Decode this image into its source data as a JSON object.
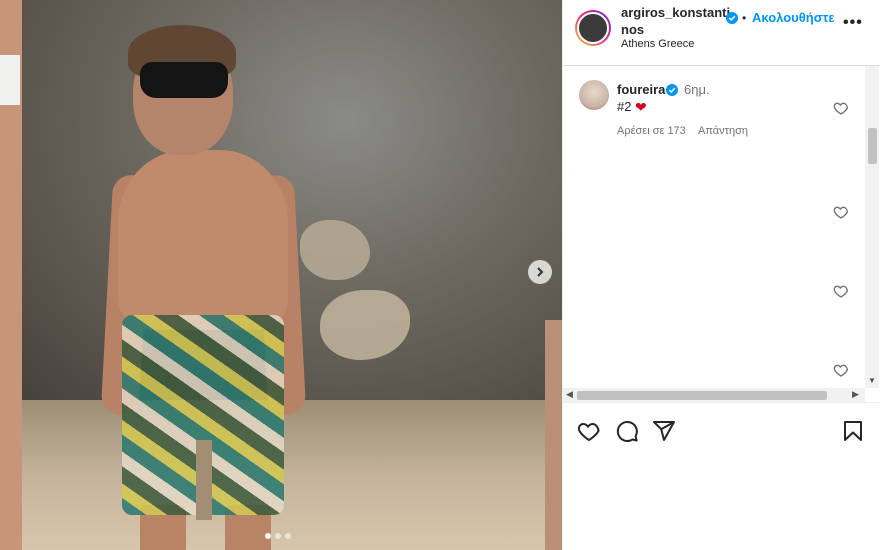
{
  "post": {
    "media": {
      "next_icon": "chevron-right-icon",
      "slides_total": 3,
      "active_slide": 1
    },
    "header": {
      "username": "argiros_konstantinos",
      "verified_icon": "verified-badge-icon",
      "separator": "•",
      "follow_label": "Ακολουθήστε",
      "location": "Athens Greece",
      "more_icon": "more-options-icon",
      "more_label": "•••"
    },
    "comment": {
      "username": "foureira",
      "time": "6ημ.",
      "text": "#2",
      "emoji": "❤",
      "likes": "Αρέσει σε 173",
      "reply_label": "Απάντηση"
    },
    "actions": {
      "like_icon": "heart-icon",
      "comment_icon": "comment-icon",
      "share_icon": "share-icon",
      "save_icon": "bookmark-icon"
    },
    "colors": {
      "accent": "#0095f6",
      "verified": "#0095f6",
      "heart": "#d6001c"
    }
  }
}
